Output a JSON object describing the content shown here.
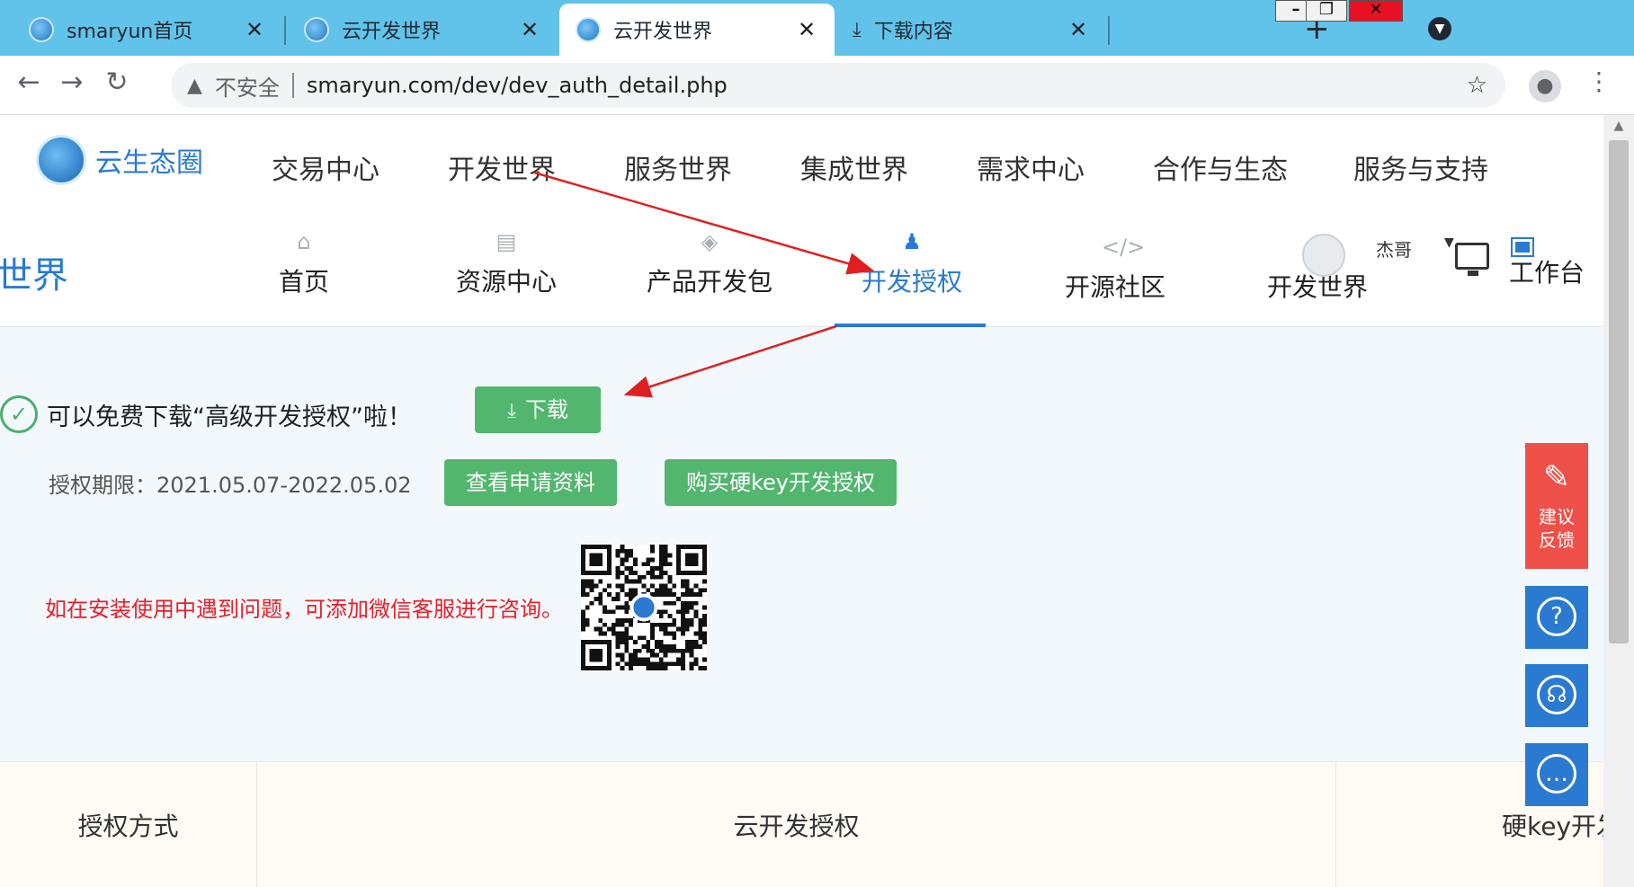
{
  "browser": {
    "tabs": [
      {
        "title": "smaryun首页",
        "icon": "globe-icon",
        "active": false
      },
      {
        "title": "云开发世界",
        "icon": "globe-icon",
        "active": false
      },
      {
        "title": "云开发世界",
        "icon": "globe-icon",
        "active": true
      },
      {
        "title": "下载内容",
        "icon": "download-icon",
        "active": false
      }
    ],
    "new_tab_label": "+",
    "close_label": "✕",
    "address": {
      "security_warning": "不安全",
      "url": "smaryun.com/dev/dev_auth_detail.php"
    }
  },
  "site": {
    "logo_text": "云生态圈",
    "main_nav": [
      "交易中心",
      "开发世界",
      "服务世界",
      "集成世界",
      "需求中心",
      "合作与生态",
      "服务与支持"
    ],
    "sub_title": "世界",
    "sub_nav": [
      {
        "label": "首页",
        "icon": "home-icon",
        "active": false
      },
      {
        "label": "资源中心",
        "icon": "resource-icon",
        "active": false
      },
      {
        "label": "产品开发包",
        "icon": "package-icon",
        "active": false
      },
      {
        "label": "开发授权",
        "icon": "authorization-icon",
        "active": true
      },
      {
        "label": "开源社区",
        "icon": "code-icon",
        "active": false
      },
      {
        "label": "开发世界",
        "icon": "world-icon",
        "active": false
      }
    ],
    "user_name": "杰哥",
    "workbench_label": "工作台"
  },
  "content": {
    "success_message": "可以免费下载“高级开发授权”啦！",
    "download_button": "下载",
    "period_label": "授权期限：",
    "period_value": "2021.05.07-2022.05.02",
    "view_application_button": "查看申请资料",
    "buy_button": "购买硬key开发授权",
    "help_text": "如在安装使用中遇到问题，可添加微信客服进行咨询。"
  },
  "table": {
    "headers": [
      "授权方式",
      "云开发授权",
      "硬key开发授权"
    ]
  },
  "side_buttons": {
    "feedback_label": "建议反馈",
    "feedback_line1": "建议",
    "feedback_line2": "反馈"
  },
  "colors": {
    "tab_strip": "#62c3ea",
    "brand_blue": "#2a7ad1",
    "button_green": "#52b66f",
    "help_red": "#e8202a",
    "feedback_red": "#f0504a",
    "annotation_red": "#e02020"
  }
}
